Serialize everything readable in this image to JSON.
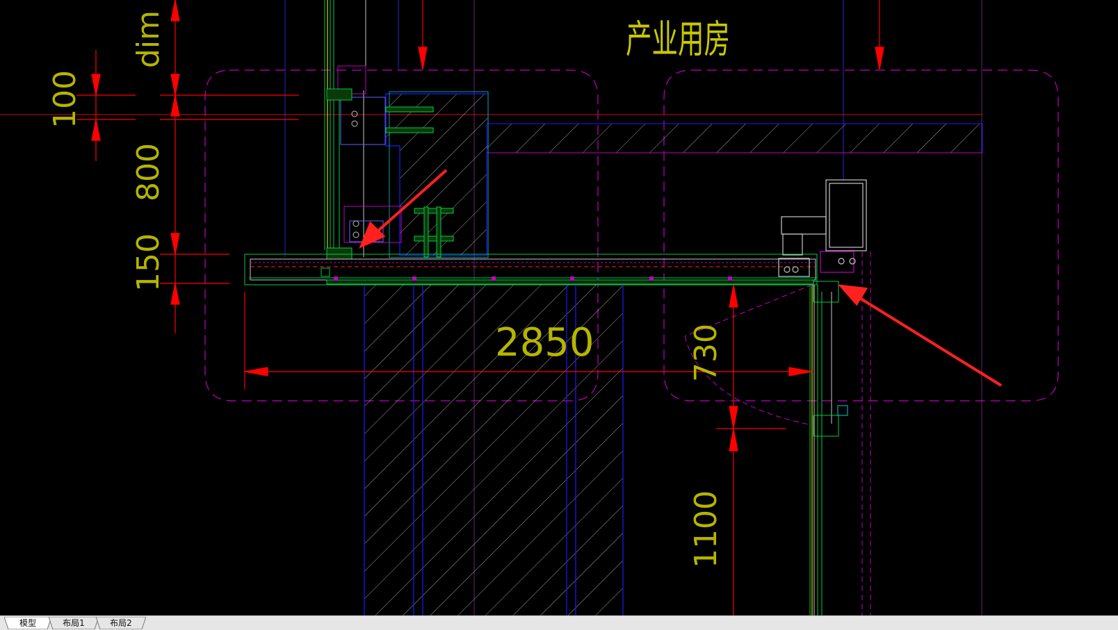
{
  "drawing": {
    "room_label": "产业用房",
    "dims": {
      "top_label": "dim",
      "d100": "100",
      "d800": "800",
      "d150": "150",
      "d2850": "2850",
      "d730": "730",
      "d1100": "1100"
    }
  },
  "tabs": [
    {
      "label": "模型",
      "active": true
    },
    {
      "label": "布局1",
      "active": false
    },
    {
      "label": "布局2",
      "active": false
    }
  ],
  "colors": {
    "background": "#000000",
    "dimension": "#ff0000",
    "dim_text": "#b5b500",
    "room_outline": "#c000c0",
    "structure": "#1a1aff",
    "profile": "#00cc44",
    "pointer_arrow": "#ff2020"
  }
}
